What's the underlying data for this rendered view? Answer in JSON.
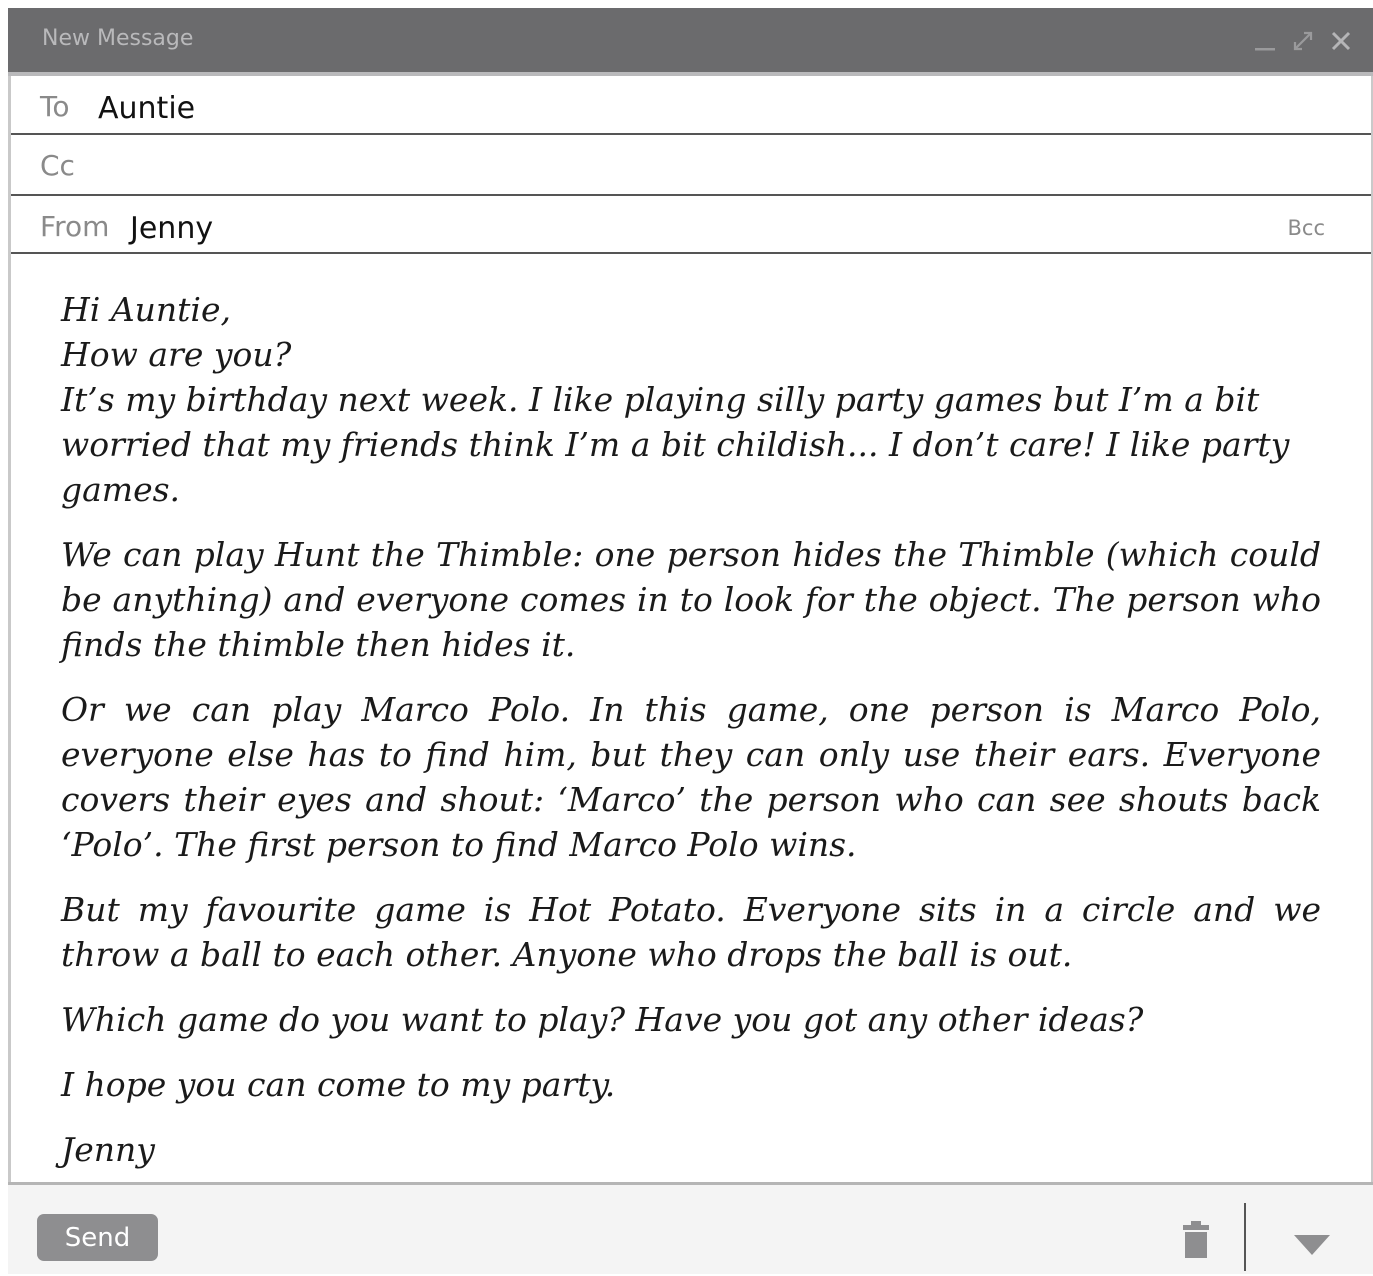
{
  "window": {
    "title": "New Message",
    "controls": [
      "minimize-icon",
      "expand-icon",
      "close-icon"
    ]
  },
  "fields": {
    "to_label": "To",
    "to_value": "Auntie",
    "cc_label": "Cc",
    "cc_value": "",
    "from_label": "From",
    "from_value": "Jenny",
    "bcc_label": "Bcc"
  },
  "message": {
    "greeting": "Hi Auntie,",
    "line2": "How are you?",
    "para1": "It’s my birthday next week. I like playing silly party games but I’m a bit worried that my friends think I’m a bit childish... I don’t care! I like party games.",
    "para2": "We can play Hunt the Thimble: one person hides the Thimble (which could be anything) and everyone comes in to look for the object. The person who finds the thimble then hides it.",
    "para3": "Or we can play Marco Polo. In this game, one person is Marco Polo, everyone else has to find him, but they can only use their ears. Everyone covers their eyes and shout: ‘Marco’ the person who can see shouts back ‘Polo’. The first person to find Marco Polo wins.",
    "para4": "But my favourite game is Hot Potato. Everyone sits in a circle and we throw a ball to each other. Anyone who drops the ball is out.",
    "para5": "Which game do you want to play? Have you got any other ideas?",
    "para6": "I hope you can come to my party.",
    "signature": "Jenny"
  },
  "footer": {
    "send_label": "Send",
    "icons": [
      "trash-icon",
      "chevron-down-icon"
    ]
  },
  "colors": {
    "titlebar": "#6b6b6d",
    "send_button": "#8e8e90",
    "footer_bg": "#f4f4f4"
  }
}
